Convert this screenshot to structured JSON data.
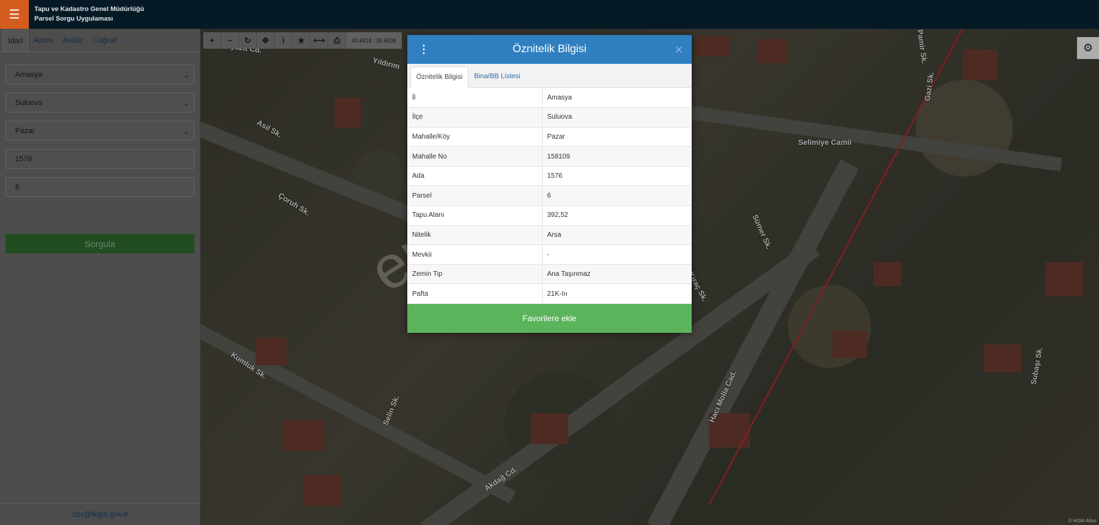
{
  "header": {
    "org_line1": "Tapu ve Kadastro Genel Müdürlüğü",
    "org_line2": "Parsel Sorgu Uygulaması"
  },
  "sidebar": {
    "tabs": [
      "İdari",
      "Adres",
      "Analiz",
      "Coğrafi"
    ],
    "il": "Amasya",
    "ilce": "Suluova",
    "mahalle": "Pazar",
    "ada": "1576",
    "parsel": "6",
    "sorgula_label": "Sorgula",
    "footer_email": "cbs@tkgm.gov.tr"
  },
  "map": {
    "coordinates": "40.8418 : 35.6508",
    "credit": "© HGM Atlas",
    "streets": [
      "Beyazıt Cd.",
      "Yıldırım",
      "Asil Sk.",
      "Çoruh Sk.",
      "Kumluk Sk.",
      "Selin Sk.",
      "Akdağ Cd.",
      "Hacı Molla Cad.",
      "Sümer Sk.",
      "Gazi Sk.",
      "Pamir Sk.",
      "Kıraç Sk.",
      "Subaşı Sk.",
      "Selimiye Camii"
    ]
  },
  "modal": {
    "title": "Öznitelik Bilgisi",
    "tabs": [
      "Öznitelik Bilgisi",
      "Bina/BB Listesi"
    ],
    "rows": [
      {
        "k": "İl",
        "v": "Amasya"
      },
      {
        "k": "İlçe",
        "v": "Suluova"
      },
      {
        "k": "Mahalle/Köy",
        "v": "Pazar"
      },
      {
        "k": "Mahalle No",
        "v": "158109"
      },
      {
        "k": "Ada",
        "v": "1576"
      },
      {
        "k": "Parsel",
        "v": "6"
      },
      {
        "k": "Tapu Alanı",
        "v": "392,52"
      },
      {
        "k": "Nitelik",
        "v": "Arsa"
      },
      {
        "k": "Mevkii",
        "v": "-"
      },
      {
        "k": "Zemin Tip",
        "v": "Ana Taşınmaz"
      },
      {
        "k": "Pafta",
        "v": "21K-Iıı"
      }
    ],
    "favorite_label": "Favorilere ekle"
  },
  "watermark": "emlakjet.com"
}
